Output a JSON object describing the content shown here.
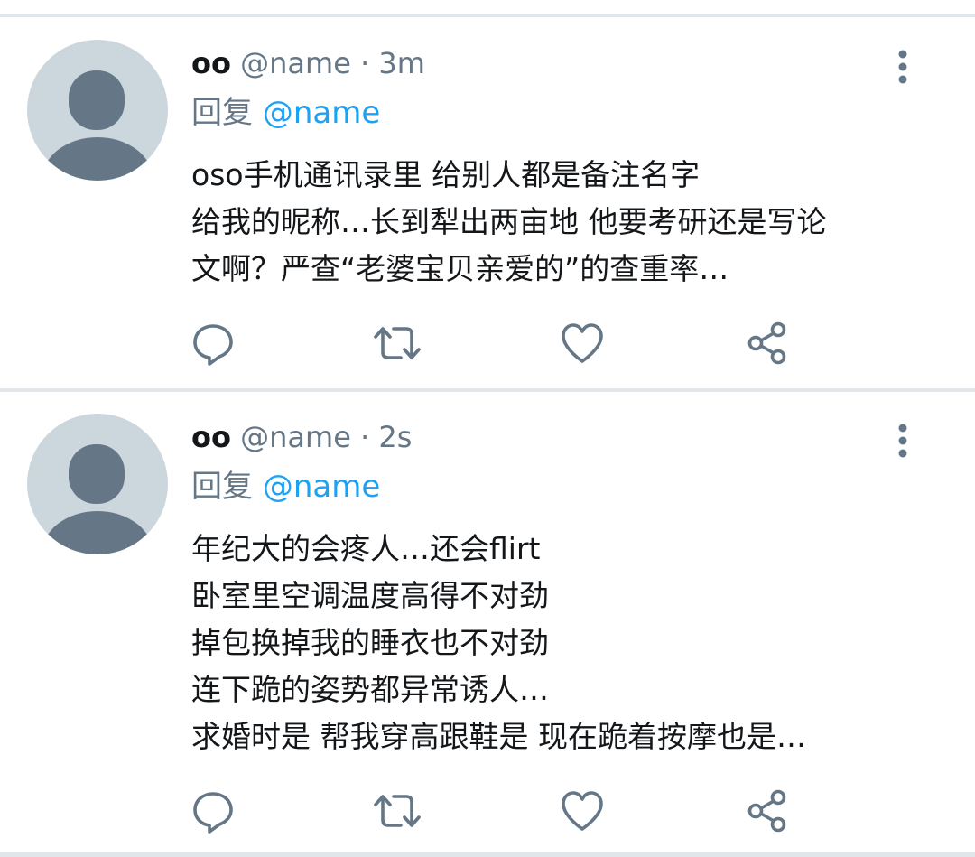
{
  "tweets": [
    {
      "display_name": "oo",
      "handle": "@name",
      "dot": "·",
      "time": "3m",
      "reply_label": "回复",
      "reply_handle": "@name",
      "lines": [
        "oso手机通讯录里 给别人都是备注名字",
        "给我的昵称…长到犁出两亩地 他要考研还是写论",
        "文啊？严查“老婆宝贝亲爱的”的查重率…"
      ]
    },
    {
      "display_name": "oo",
      "handle": "@name",
      "dot": "·",
      "time": "2s",
      "reply_label": "回复",
      "reply_handle": "@name",
      "lines": [
        "年纪大的会疼人…还会flirt",
        "卧室里空调温度高得不对劲",
        "掉包换掉我的睡衣也不对劲",
        "连下跪的姿势都异常诱人…",
        "求婚时是 帮我穿高跟鞋是 现在跪着按摩也是…"
      ]
    }
  ],
  "icons": {
    "avatar": "default-avatar-icon",
    "more": "more-vertical-icon",
    "reply": "reply-icon",
    "retweet": "retweet-icon",
    "like": "heart-icon",
    "share": "share-icon"
  },
  "colors": {
    "text": "#14171a",
    "secondary": "#657786",
    "link": "#1da1f2",
    "icon": "#657786",
    "avatar_bg": "#ccd6dd",
    "avatar_fg": "#657786",
    "separator": "#e1e6ea"
  }
}
